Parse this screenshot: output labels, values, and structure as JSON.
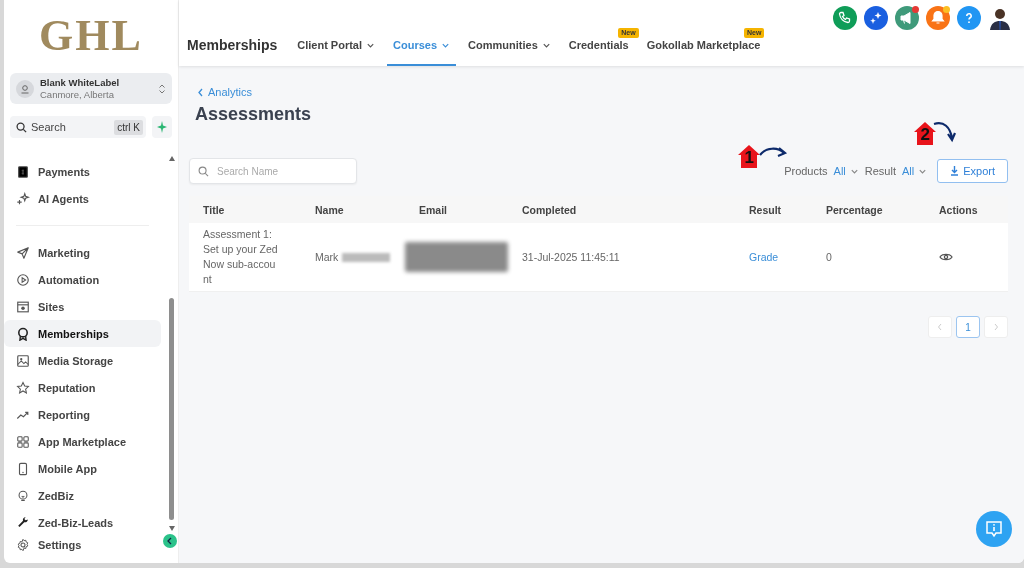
{
  "sidebar": {
    "logo": "GHL",
    "account": {
      "name": "Blank WhiteLabel",
      "location": "Canmore, Alberta"
    },
    "search": {
      "placeholder": "Search",
      "shortcut": "ctrl K"
    },
    "sections": [
      {
        "items": [
          {
            "label": "Payments",
            "selected": false
          },
          {
            "label": "AI Agents",
            "selected": false
          }
        ]
      },
      {
        "items": [
          {
            "label": "Marketing",
            "selected": false
          },
          {
            "label": "Automation",
            "selected": false
          },
          {
            "label": "Sites",
            "selected": false
          },
          {
            "label": "Memberships",
            "selected": true
          },
          {
            "label": "Media Storage",
            "selected": false
          },
          {
            "label": "Reputation",
            "selected": false
          },
          {
            "label": "Reporting",
            "selected": false
          },
          {
            "label": "App Marketplace",
            "selected": false
          },
          {
            "label": "Mobile App",
            "selected": false
          },
          {
            "label": "ZedBiz",
            "selected": false
          },
          {
            "label": "Zed-Biz-Leads",
            "selected": false
          }
        ]
      }
    ],
    "footer": {
      "label": "Settings",
      "selected": false
    }
  },
  "header": {
    "title": "Memberships",
    "tabs": [
      {
        "label": "Client Portal",
        "selected": false,
        "dropdown": true
      },
      {
        "label": "Courses",
        "selected": true,
        "dropdown": true
      },
      {
        "label": "Communities",
        "selected": false,
        "dropdown": true
      },
      {
        "label": "Credentials",
        "selected": false,
        "dropdown": false,
        "badge": "New"
      },
      {
        "label": "Gokollab Marketplace",
        "selected": false,
        "dropdown": false,
        "badge": "New"
      }
    ],
    "actions": [
      {
        "kind": "phone",
        "color": "#0f9d58",
        "notification": false
      },
      {
        "kind": "sparkle",
        "color": "#1a5fe0",
        "notification": false
      },
      {
        "kind": "megaphone",
        "color": "#3f9a7a",
        "notification": true
      },
      {
        "kind": "bell",
        "color": "#f97316",
        "notification": true
      },
      {
        "kind": "help",
        "color": "#2196f3",
        "notification": false
      }
    ]
  },
  "page": {
    "back_link": "Analytics",
    "title": "Assessments",
    "search": {
      "placeholder": "Search Name"
    },
    "filters": [
      {
        "label": "Products",
        "value": "All"
      },
      {
        "label": "Result",
        "value": "All"
      }
    ],
    "export_button": "Export",
    "annotations": [
      {
        "label": "1"
      },
      {
        "label": "2"
      }
    ],
    "table": {
      "columns": [
        "Title",
        "Name",
        "Email",
        "Completed",
        "Result",
        "Percentage",
        "Actions"
      ],
      "rows": [
        {
          "title": "Assessment 1: Set up your Zed Now sub-account",
          "name": "Mark",
          "completed": "31-Jul-2025 11:45:11",
          "result": "Grade",
          "percentage": "0"
        }
      ]
    },
    "pagination": [
      {
        "label": "1",
        "selected": true
      }
    ]
  }
}
